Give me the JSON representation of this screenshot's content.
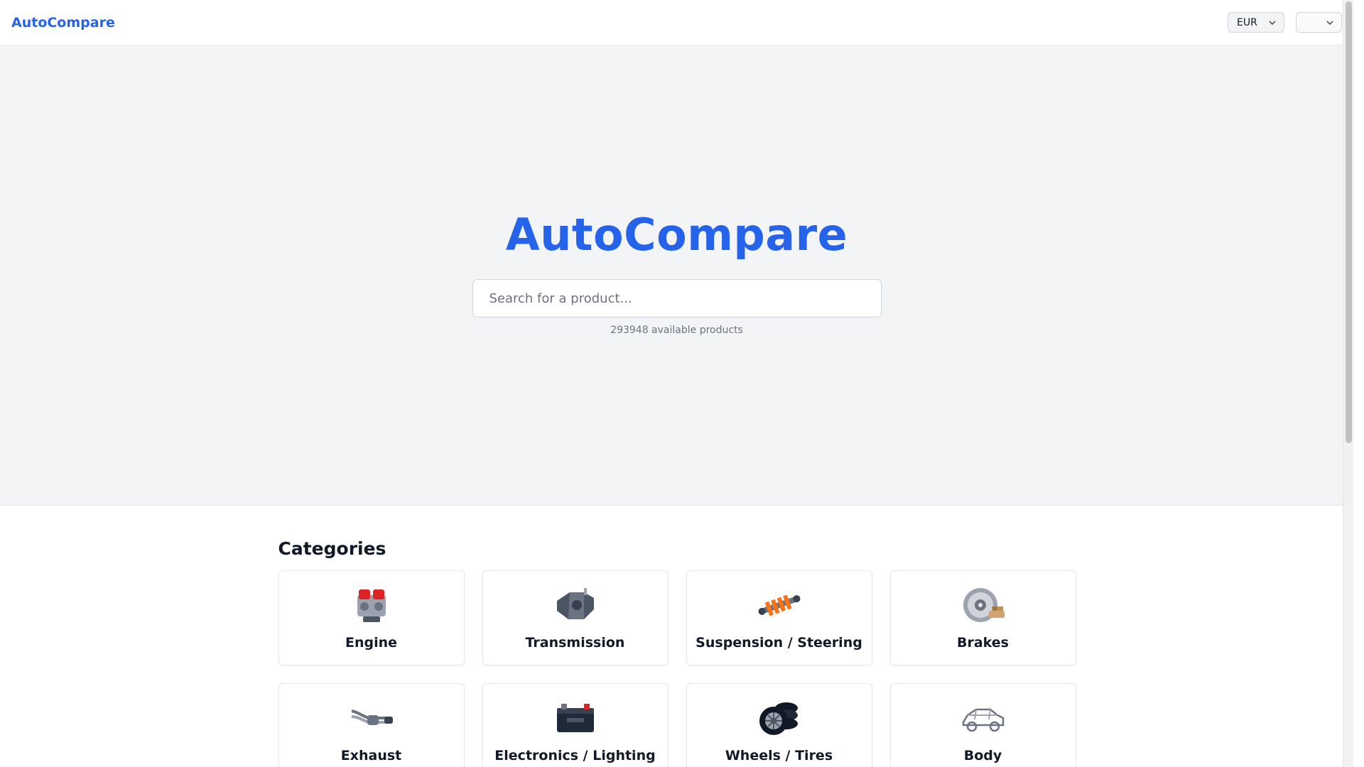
{
  "header": {
    "brand": "AutoCompare",
    "currency_select": {
      "value": "EUR"
    },
    "language_select": {
      "value": ""
    }
  },
  "hero": {
    "title": "AutoCompare",
    "search": {
      "placeholder": "Search for a product...",
      "value": ""
    },
    "product_count_text": "293948 available products"
  },
  "categories": {
    "heading": "Categories",
    "items": [
      {
        "label": "Engine",
        "icon": "engine-icon"
      },
      {
        "label": "Transmission",
        "icon": "transmission-icon"
      },
      {
        "label": "Suspension / Steering",
        "icon": "shock-absorber-icon"
      },
      {
        "label": "Brakes",
        "icon": "brake-disc-icon"
      },
      {
        "label": "Exhaust",
        "icon": "exhaust-icon"
      },
      {
        "label": "Electronics / Lighting",
        "icon": "battery-icon"
      },
      {
        "label": "Wheels / Tires",
        "icon": "tires-icon"
      },
      {
        "label": "Body",
        "icon": "car-body-icon"
      }
    ]
  },
  "colors": {
    "brand": "#2563eb",
    "hero_bg": "#f3f4f6",
    "text": "#111827",
    "muted": "#6b7280",
    "border": "#e5e7eb"
  }
}
